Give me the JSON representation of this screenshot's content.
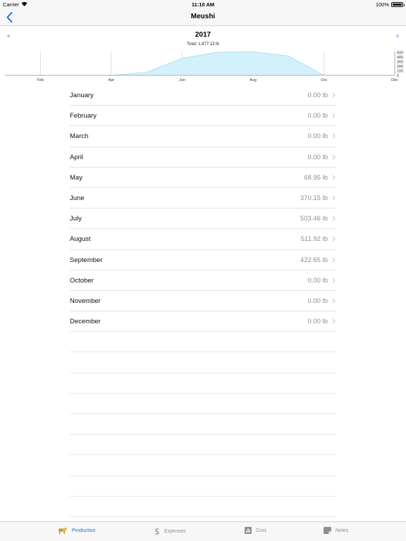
{
  "status_bar": {
    "carrier": "Carrier",
    "time": "11:10 AM",
    "battery": "100%"
  },
  "nav": {
    "title": "Meushi"
  },
  "chart_header": {
    "prev_label": "<",
    "next_label": ">",
    "year": "2017",
    "total": "Total: 1,877.13 lb"
  },
  "chart_data": {
    "type": "area",
    "x": [
      1,
      2,
      3,
      4,
      5,
      6,
      7,
      8,
      9,
      10,
      11,
      12
    ],
    "values": [
      0,
      0,
      0,
      0,
      68.95,
      370.15,
      503.46,
      511.92,
      422.65,
      0,
      0,
      0
    ],
    "x_tick_labels": [
      "Feb",
      "Apr",
      "Jun",
      "Aug",
      "Oct",
      "Dec"
    ],
    "x_tick_positions": [
      2,
      4,
      6,
      8,
      10,
      12
    ],
    "y_tick_labels": [
      "500",
      "400",
      "300",
      "200",
      "100",
      "0"
    ],
    "y_tick_values": [
      500,
      400,
      300,
      200,
      100,
      0
    ],
    "ylim": [
      0,
      520
    ],
    "xlim": [
      1,
      12
    ],
    "grid": true,
    "fill_color": "#d2f1fb",
    "line_color": "#9fdcf2"
  },
  "months": [
    {
      "name": "January",
      "value": "0.00 lb"
    },
    {
      "name": "February",
      "value": "0.00 lb"
    },
    {
      "name": "March",
      "value": "0.00 lb"
    },
    {
      "name": "April",
      "value": "0.00 lb"
    },
    {
      "name": "May",
      "value": "68.95 lb"
    },
    {
      "name": "June",
      "value": "370.15 lb"
    },
    {
      "name": "July",
      "value": "503.46 lb"
    },
    {
      "name": "August",
      "value": "511.92 lb"
    },
    {
      "name": "September",
      "value": "422.65 lb"
    },
    {
      "name": "October",
      "value": "0.00 lb"
    },
    {
      "name": "November",
      "value": "0.00 lb"
    },
    {
      "name": "December",
      "value": "0.00 lb"
    }
  ],
  "tabs": [
    {
      "label": "Production",
      "icon": "cow-icon",
      "active": true
    },
    {
      "label": "Expenses",
      "icon": "dollar-icon",
      "active": false
    },
    {
      "label": "Cost",
      "icon": "bar-chart-icon",
      "active": false
    },
    {
      "label": "Notes",
      "icon": "note-icon",
      "active": false
    }
  ],
  "colors": {
    "accent": "#1e6fe0",
    "secondary_text": "#8e8e93"
  }
}
